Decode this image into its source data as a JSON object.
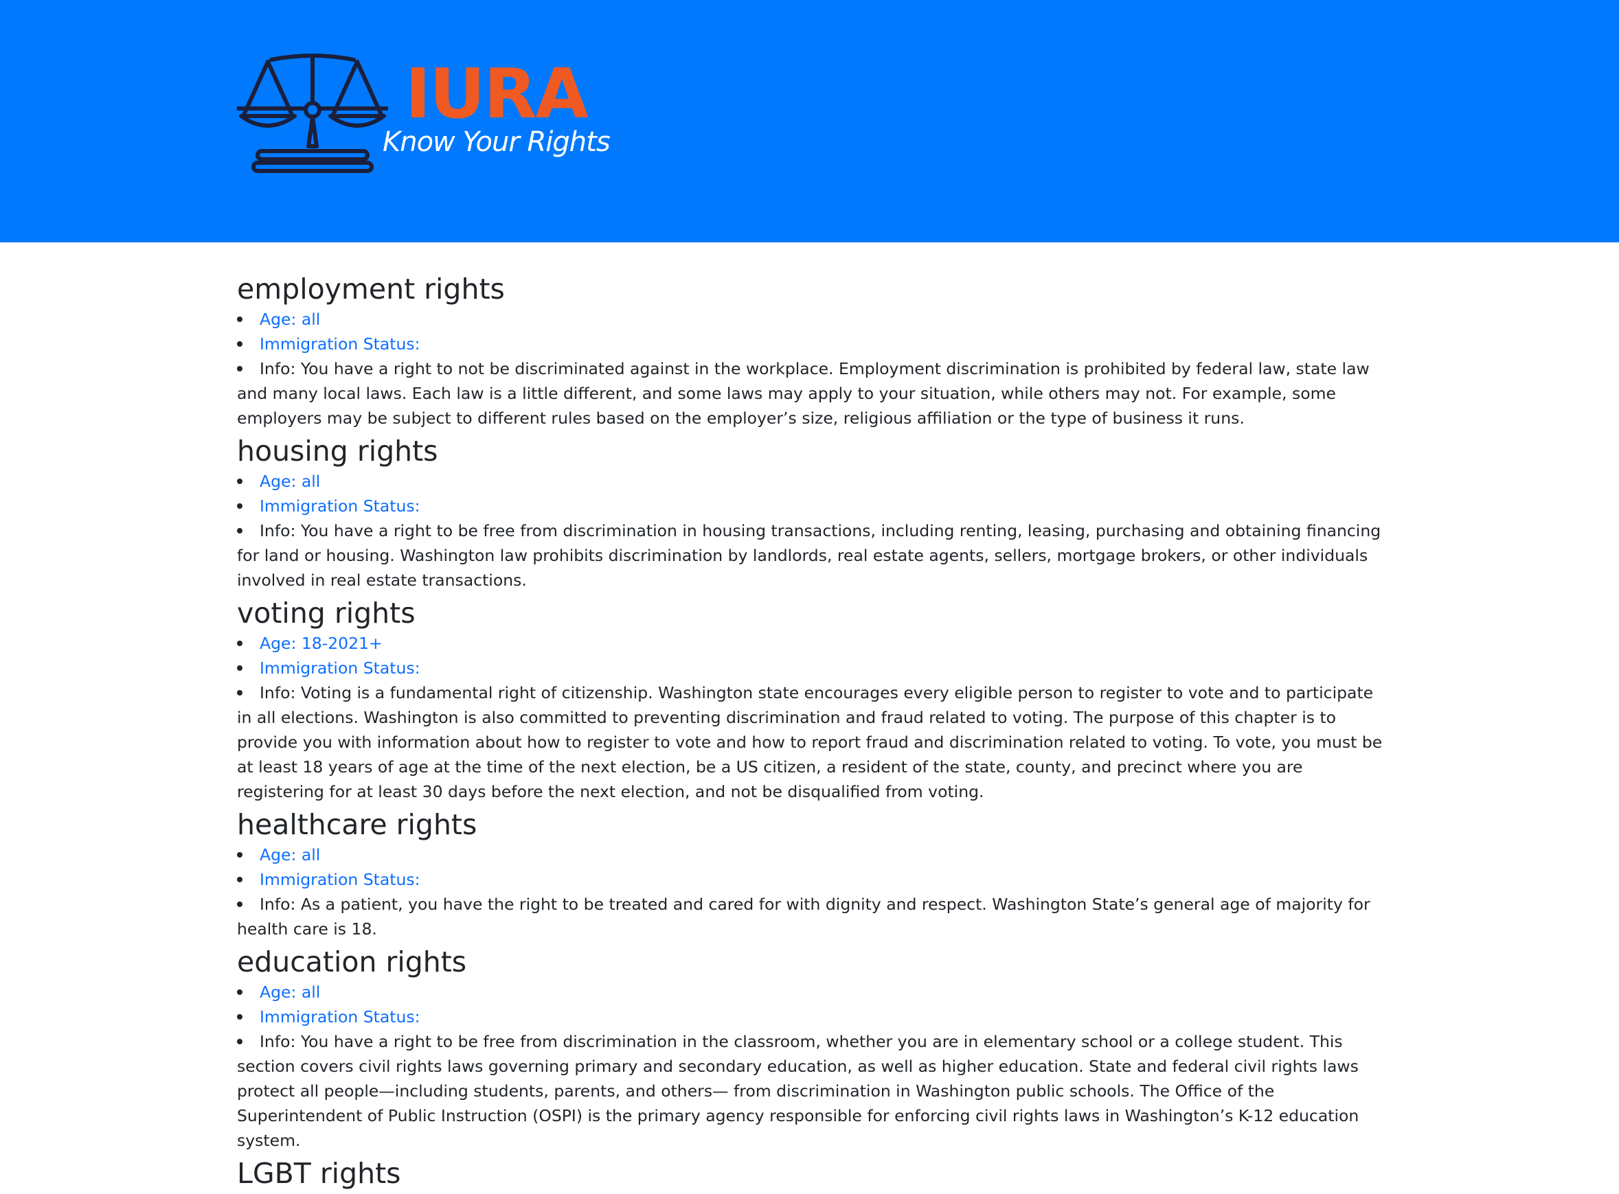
{
  "header": {
    "brand": "IURA",
    "tagline": "Know Your Rights",
    "colors": {
      "background": "#0079fe",
      "brand": "#f05a22",
      "logo_stroke": "#1b1f3b"
    },
    "logo_icon": "scales-of-justice-icon"
  },
  "sections": [
    {
      "title": "employment rights",
      "age": "Age: all",
      "immigration": "Immigration Status:",
      "info": "Info: You have a right to not be discriminated against in the workplace. Employment discrimination is prohibited by federal law, state law and many local laws. Each law is a little different, and some laws may apply to your situation, while others may not. For example, some employers may be subject to different rules based on the employer’s size, religious affiliation or the type of business it runs."
    },
    {
      "title": "housing rights",
      "age": "Age: all",
      "immigration": "Immigration Status:",
      "info": "Info: You have a right to be free from discrimination in housing transactions, including renting, leasing, purchasing and obtaining financing for land or housing. Washington law prohibits discrimination by landlords, real estate agents, sellers, mortgage brokers, or other individuals involved in real estate transactions."
    },
    {
      "title": "voting rights",
      "age": "Age: 18-2021+",
      "immigration": "Immigration Status:",
      "info": "Info: Voting is a fundamental right of citizenship. Washington state encourages every eligible person to register to vote and to participate in all elections. Washington is also committed to preventing discrimination and fraud related to voting. The purpose of this chapter is to provide you with information about how to register to vote and how to report fraud and discrimination related to voting. To vote, you must be at least 18 years of age at the time of the next election, be a US citizen, a resident of the state, county, and precinct where you are registering for at least 30 days before the next election, and not be disqualified from voting."
    },
    {
      "title": "healthcare rights",
      "age": "Age: all",
      "immigration": "Immigration Status:",
      "info": "Info: As a patient, you have the right to be treated and cared for with dignity and respect. Washington State’s general age of majority for health care is 18."
    },
    {
      "title": "education rights",
      "age": "Age: all",
      "immigration": "Immigration Status:",
      "info": "Info: You have a right to be free from discrimination in the classroom, whether you are in elementary school or a college student. This section covers civil rights laws governing primary and secondary education, as well as higher education. State and federal civil rights laws protect all people—including students, parents, and others— from discrimination in Washington public schools. The Office of the Superintendent of Public Instruction (OSPI) is the primary agency responsible for enforcing civil rights laws in Washington’s K-12 education system."
    },
    {
      "title": "LGBT rights"
    }
  ]
}
